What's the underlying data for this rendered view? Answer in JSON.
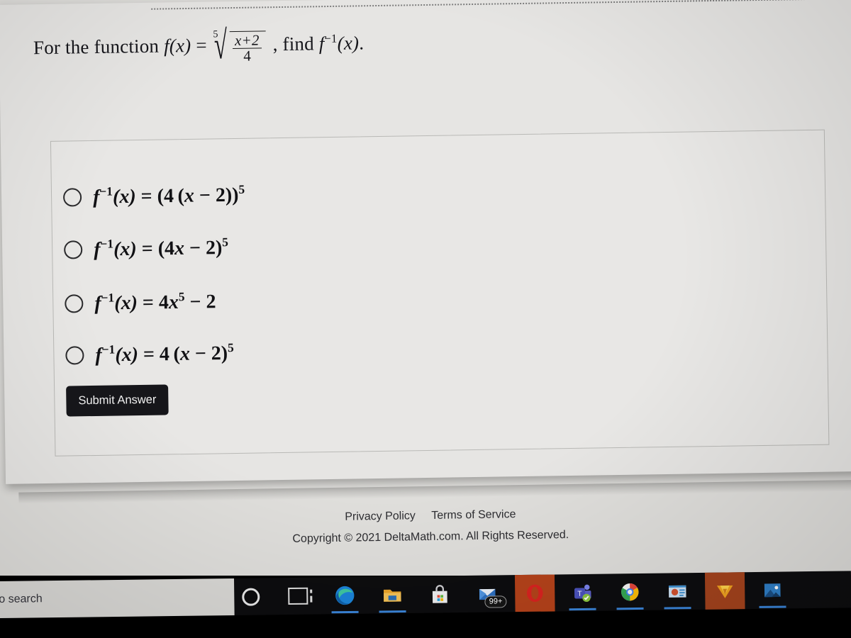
{
  "question": {
    "prefix": "For the function",
    "func_name": "f",
    "func_arg": "(x)",
    "equals": "=",
    "root_index": "5",
    "numerator": "x+2",
    "denominator": "4",
    "middle": ", find",
    "inverse_name": "f",
    "inverse_exp": "−1",
    "inverse_arg": "(x)",
    "period": ".",
    "plain_text": "For the function f(x) = 5th-root((x+2)/4), find f^-1(x)."
  },
  "choices": [
    {
      "id": "choice-a",
      "latex_text": "f⁻¹(x) = (4 (x − 2))⁵",
      "selected": false
    },
    {
      "id": "choice-b",
      "latex_text": "f⁻¹(x) = (4x − 2)⁵",
      "selected": false
    },
    {
      "id": "choice-c",
      "latex_text": "f⁻¹(x) = 4x⁵ − 2",
      "selected": false
    },
    {
      "id": "choice-d",
      "latex_text": "f⁻¹(x) = 4 (x − 2)⁵",
      "selected": false
    }
  ],
  "submit": {
    "label": "Submit Answer"
  },
  "footer": {
    "privacy_policy": "Privacy Policy",
    "terms_of_service": "Terms of Service",
    "copyright": "Copyright © 2021 DeltaMath.com. All Rights Reserved."
  },
  "taskbar": {
    "search_text": "o search",
    "items": [
      {
        "name": "cortana-icon",
        "label": "Cortana"
      },
      {
        "name": "task-view-icon",
        "label": "Task View"
      },
      {
        "name": "microsoft-edge-icon",
        "label": "Microsoft Edge"
      },
      {
        "name": "file-explorer-icon",
        "label": "File Explorer"
      },
      {
        "name": "microsoft-store-icon",
        "label": "Microsoft Store"
      },
      {
        "name": "mail-icon",
        "label": "Mail",
        "badge": "99+"
      },
      {
        "name": "opera-icon",
        "label": "Opera"
      },
      {
        "name": "microsoft-teams-icon",
        "label": "Microsoft Teams"
      },
      {
        "name": "google-chrome-icon",
        "label": "Google Chrome"
      },
      {
        "name": "powerpoint-icon",
        "label": "PowerPoint"
      },
      {
        "name": "wondershare-icon",
        "label": "Wondershare"
      },
      {
        "name": "photos-icon",
        "label": "Photos"
      }
    ]
  },
  "colors": {
    "page_bg": "#dfdedb",
    "card_bg": "#e8e7e5",
    "submit_bg": "#16161a",
    "taskbar_bg": "#0d0d0f",
    "accent_blue": "#3a84d8",
    "highlight_orange": "#b4421a"
  }
}
